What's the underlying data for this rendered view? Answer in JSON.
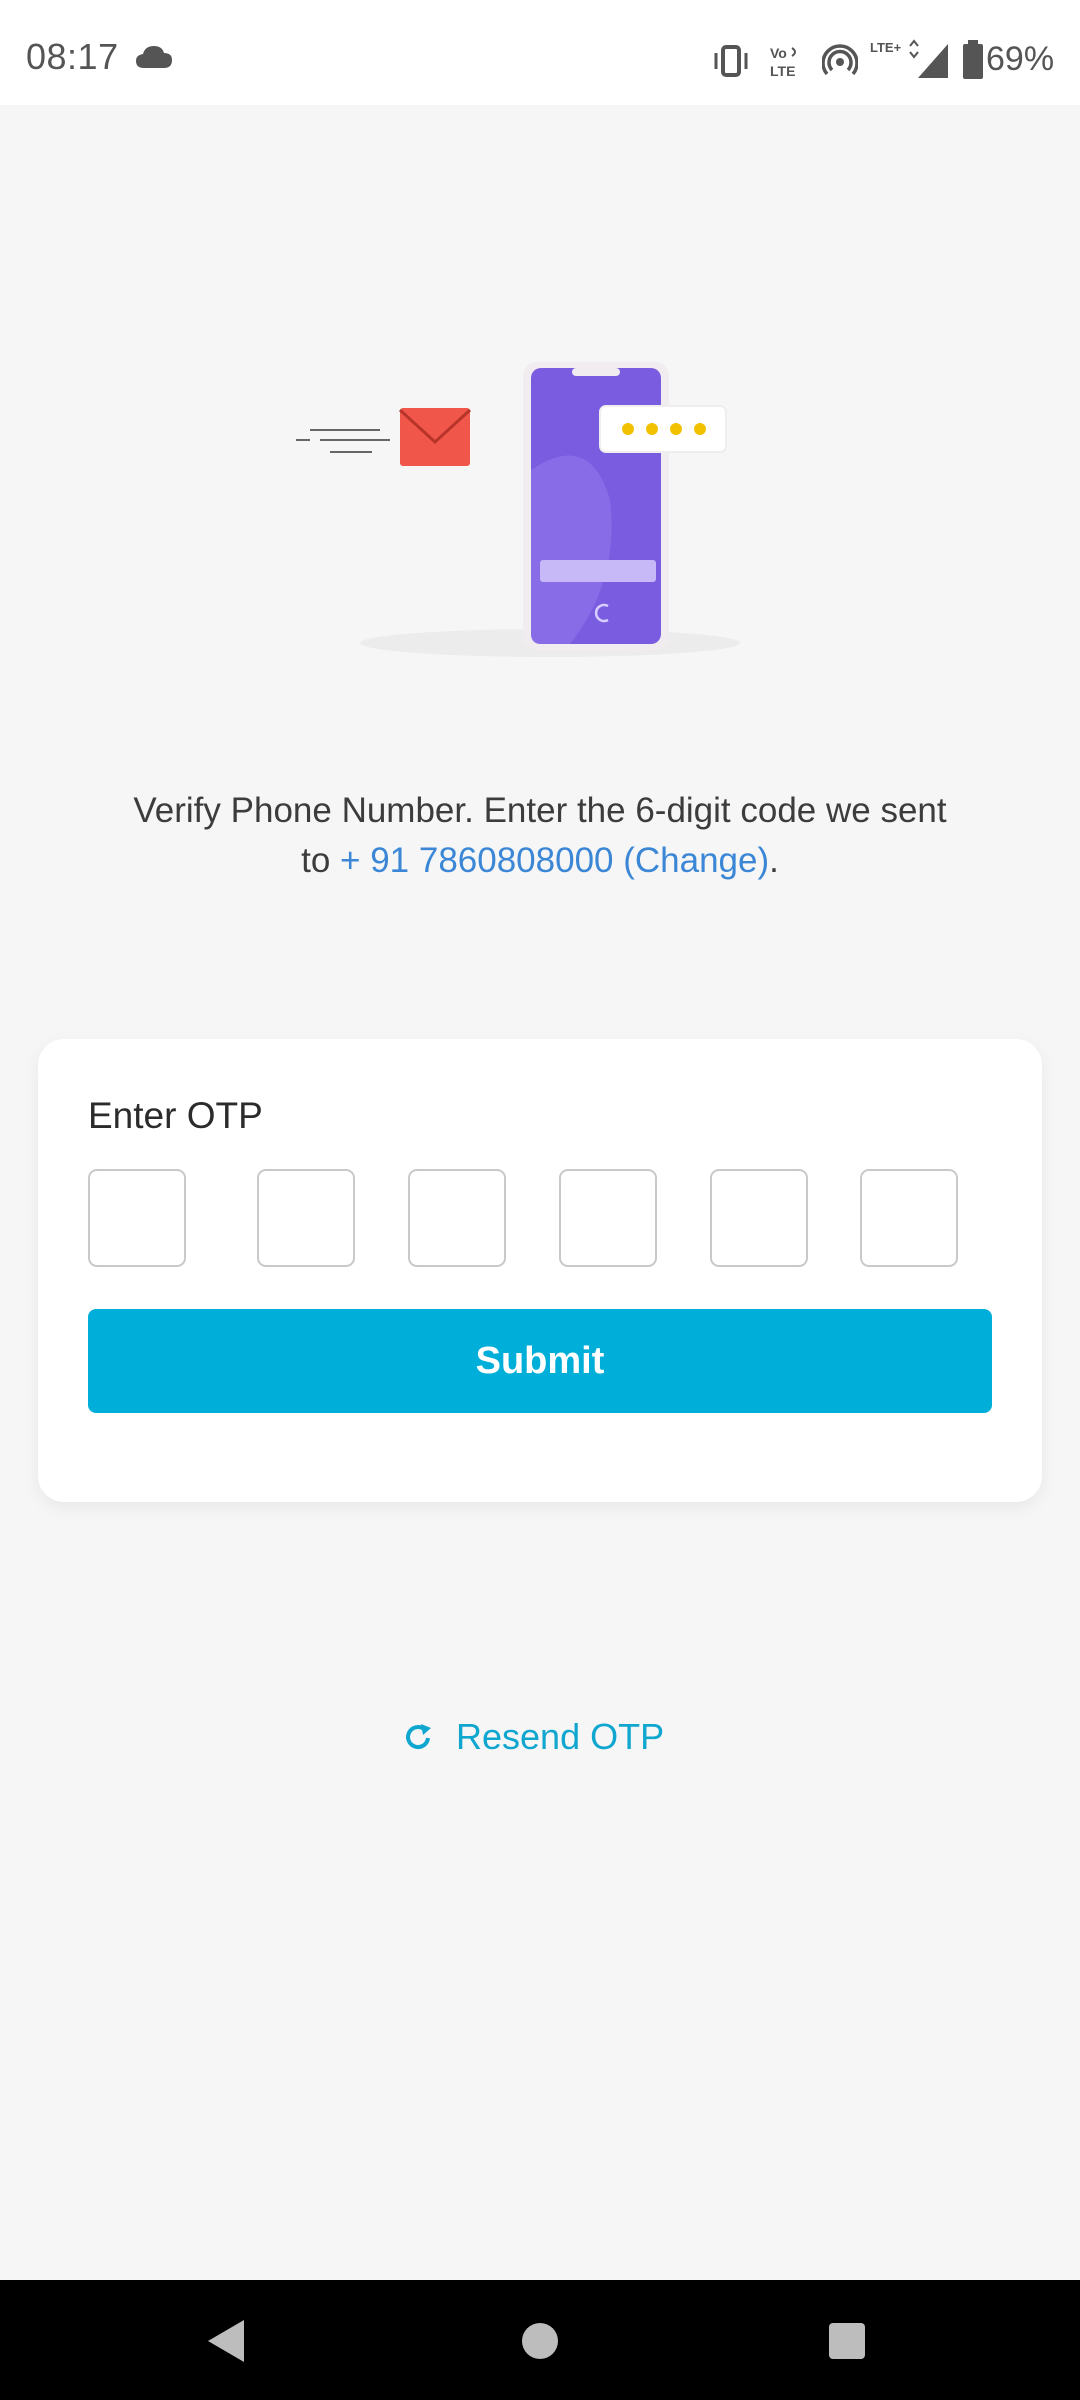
{
  "status_bar": {
    "time": "08:17",
    "weather_icon": "cloud-icon",
    "indicators": [
      "vibrate-icon",
      "volte-icon",
      "hotspot-icon",
      "lte-signal-icon",
      "battery-icon"
    ],
    "volte_label": "Vo LTE",
    "lte_label": "LTE+",
    "battery": "69%"
  },
  "illustration": {
    "icon": "otp-phone-illustration",
    "accent_colors": {
      "phone": "#7a5ce0",
      "envelope": "#f0574a",
      "dots": "#f2c200"
    }
  },
  "message": {
    "text_before": "Verify Phone Number. Enter the 6-digit code we sent to ",
    "phone_link": "+ 91 7860808000 (Change)",
    "text_after": "."
  },
  "otp_card": {
    "label": "Enter OTP",
    "digits": [
      "",
      "",
      "",
      "",
      "",
      ""
    ],
    "submit_label": "Submit"
  },
  "resend": {
    "icon": "refresh-icon",
    "label": "Resend OTP"
  },
  "nav_bar": {
    "icons": [
      "back-icon",
      "home-icon",
      "recents-icon"
    ]
  },
  "colors": {
    "accent": "#00afd9",
    "link": "#3b87d6",
    "background": "#f6f6f6"
  }
}
